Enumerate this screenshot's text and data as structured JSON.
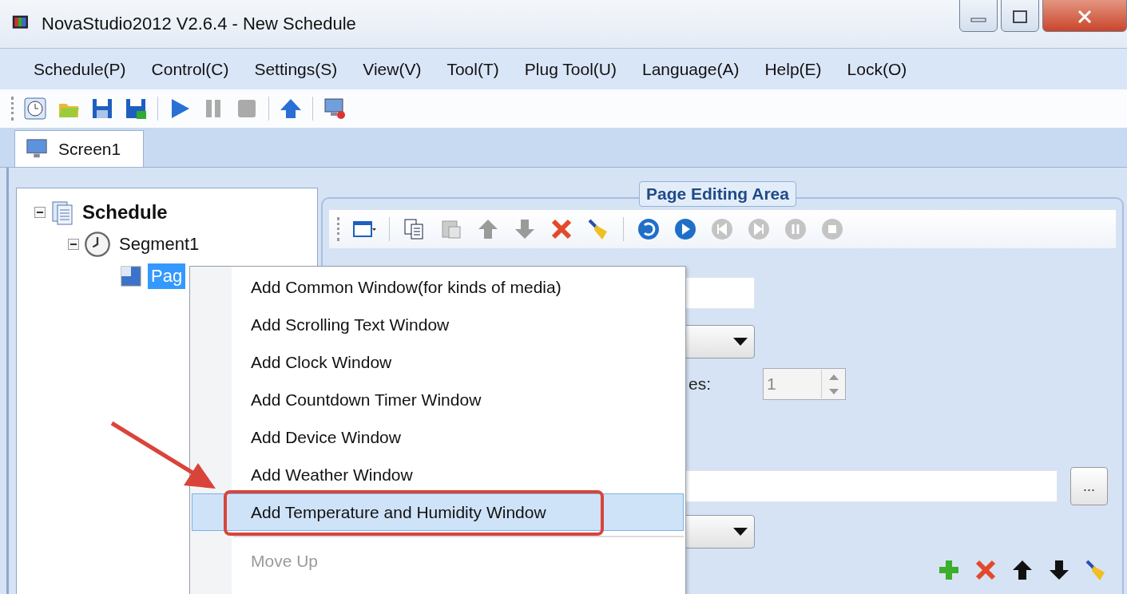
{
  "window": {
    "title": "NovaStudio2012 V2.6.4 - New Schedule"
  },
  "menu_bar": [
    "Schedule(P)",
    "Control(C)",
    "Settings(S)",
    "View(V)",
    "Tool(T)",
    "Plug Tool(U)",
    "Language(A)",
    "Help(E)",
    "Lock(O)"
  ],
  "tabs": [
    {
      "label": "Screen1",
      "selected": true
    }
  ],
  "tree": [
    {
      "label": "Schedule",
      "expanded": true,
      "selected": false,
      "children": [
        {
          "label": "Segment1",
          "expanded": true,
          "selected": false,
          "children": [
            {
              "label": "Pag",
              "selected": true
            }
          ]
        }
      ]
    }
  ],
  "page_editing_area": {
    "title": "Page Editing Area",
    "label": "es:",
    "spin_value": "1",
    "browse_button": "..."
  },
  "context_menu": [
    {
      "label": "Add Common Window(for kinds of media)",
      "selected": false,
      "disabled": false
    },
    {
      "label": "Add Scrolling Text Window",
      "selected": false,
      "disabled": false
    },
    {
      "label": "Add Clock Window",
      "selected": false,
      "disabled": false
    },
    {
      "label": "Add Countdown Timer Window",
      "selected": false,
      "disabled": false
    },
    {
      "label": "Add Device Window",
      "selected": false,
      "disabled": false
    },
    {
      "label": "Add Weather Window",
      "selected": false,
      "disabled": false
    },
    {
      "label": "Add Temperature and Humidity Window",
      "selected": true,
      "disabled": false
    },
    {
      "label": "Move Up",
      "selected": false,
      "disabled": true
    }
  ]
}
